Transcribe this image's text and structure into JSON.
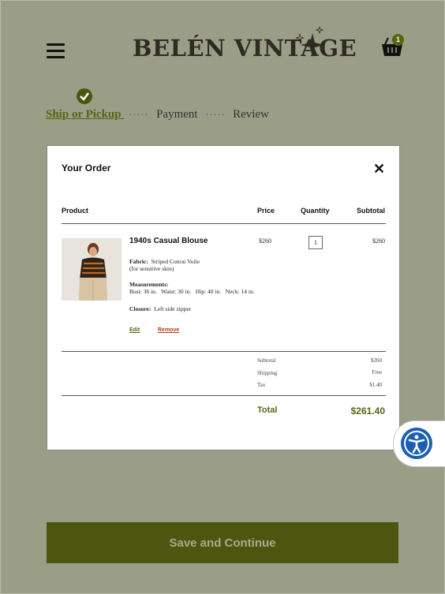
{
  "brand": {
    "logo_text": "BELÉN VINTAGE"
  },
  "header": {
    "cart_count": "1"
  },
  "checkout_steps": {
    "ship": "Ship or Pickup ",
    "separator_1": "·····",
    "payment": "Payment",
    "separator_2": "·····",
    "review": "Review"
  },
  "order": {
    "title": "Your Order",
    "columns": {
      "product": "Product",
      "price": "Price",
      "quantity": "Quantity",
      "subtotal": "Subtotal"
    },
    "item": {
      "name": "1940s Casual Blouse",
      "fabric_label": "Fabric:",
      "fabric_value": "Striped Cotton Voile",
      "fabric_note": "(for sensitive skin)",
      "measurements_label": "Measurements:",
      "measurements_value": "Bust: 36 in.   Waist: 30 in.   Hip: 40 in.   Neck: 14 in.",
      "closure_label": "Closure:",
      "closure_value": "Left side zipper",
      "price": "$260",
      "quantity": "1",
      "subtotal": "$260",
      "edit": "Edit",
      "remove": "Remove"
    },
    "summary": {
      "subtotal_label": "Subtotal",
      "subtotal_value": "$260",
      "shipping_label": "Shipping",
      "shipping_value": "Free",
      "tax_label": "Tax",
      "tax_value": "$1.40"
    },
    "total_label": "Total",
    "total_value": "$261.40"
  },
  "cta": {
    "label": "Save and Continue"
  },
  "colors": {
    "background": "#9a9e87",
    "brand_olive": "#4d560f",
    "accent_green": "#5a6314",
    "remove_red": "#b83a12",
    "a11y_blue": "#1a5fb4"
  },
  "icons": {
    "menu": "hamburger-icon",
    "cart": "basket-icon",
    "close": "close-icon",
    "step_done": "check-circle-icon",
    "accessibility": "accessibility-icon"
  }
}
